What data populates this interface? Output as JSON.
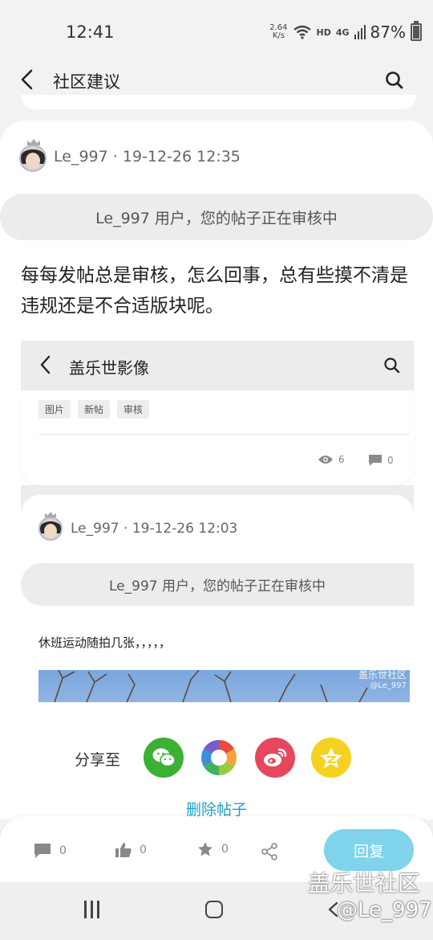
{
  "status_bar": {
    "time": "12:41",
    "net_speed_value": "2.64",
    "net_speed_unit": "K/s",
    "hd": "HD",
    "signal_type": "4G",
    "battery_percent": "87%",
    "battery_level": 0.87
  },
  "header": {
    "title": "社区建议"
  },
  "post": {
    "author": "Le_997",
    "datetime": "19-12-26 12:35",
    "review_notice": "Le_997 用户，您的帖子正在审核中",
    "body": "每每发帖总是审核，怎么回事，总有些摸不清是违规还是不合适版块呢。"
  },
  "embedded_screenshot": {
    "title": "盖乐世影像",
    "tags": [
      "图片",
      "新帖",
      "审核"
    ],
    "views": "6",
    "comments": "0",
    "inner_post": {
      "author": "Le_997",
      "datetime": "19-12-26 12:03",
      "review_notice": "Le_997 用户，您的帖子正在审核中",
      "body": "休班运动随拍几张，，，，，",
      "photo_watermark_line1": "盖乐世社区",
      "photo_watermark_line2": "@Le_997"
    }
  },
  "share": {
    "label": "分享至",
    "targets": [
      "wechat",
      "moments",
      "weibo",
      "qzone"
    ],
    "colors": {
      "wechat": "#3cb034",
      "weibo": "#e6475f",
      "qzone": "#f4d21f"
    }
  },
  "delete_label": "删除帖子",
  "actions": {
    "comments": "0",
    "likes": "0",
    "favorites": "0",
    "reply_label": "回复"
  },
  "watermark": {
    "line1": "盖乐世社区",
    "line2": "@Le_997"
  },
  "colors": {
    "accent": "#1ea1c7",
    "reply_button": "#7fd3ea",
    "background": "#f2f2f2"
  }
}
